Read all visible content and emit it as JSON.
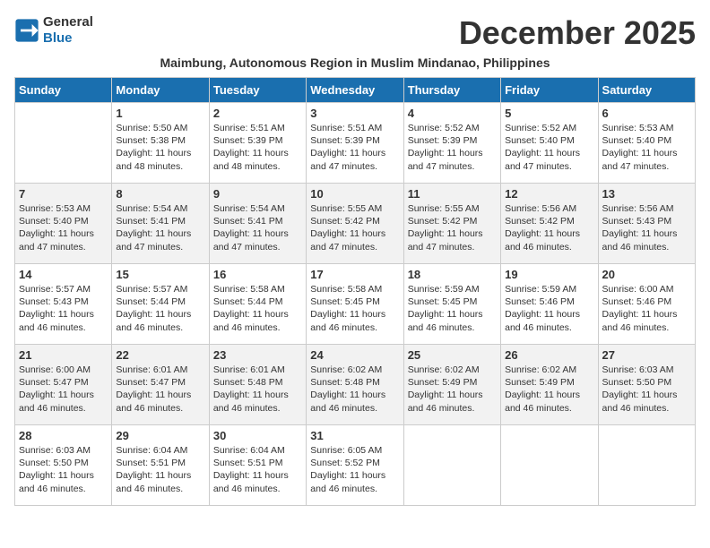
{
  "logo": {
    "text_general": "General",
    "text_blue": "Blue"
  },
  "title": "December 2025",
  "subtitle": "Maimbung, Autonomous Region in Muslim Mindanao, Philippines",
  "headers": [
    "Sunday",
    "Monday",
    "Tuesday",
    "Wednesday",
    "Thursday",
    "Friday",
    "Saturday"
  ],
  "weeks": [
    [
      {
        "day": "",
        "info": ""
      },
      {
        "day": "1",
        "info": "Sunrise: 5:50 AM\nSunset: 5:38 PM\nDaylight: 11 hours\nand 48 minutes."
      },
      {
        "day": "2",
        "info": "Sunrise: 5:51 AM\nSunset: 5:39 PM\nDaylight: 11 hours\nand 48 minutes."
      },
      {
        "day": "3",
        "info": "Sunrise: 5:51 AM\nSunset: 5:39 PM\nDaylight: 11 hours\nand 47 minutes."
      },
      {
        "day": "4",
        "info": "Sunrise: 5:52 AM\nSunset: 5:39 PM\nDaylight: 11 hours\nand 47 minutes."
      },
      {
        "day": "5",
        "info": "Sunrise: 5:52 AM\nSunset: 5:40 PM\nDaylight: 11 hours\nand 47 minutes."
      },
      {
        "day": "6",
        "info": "Sunrise: 5:53 AM\nSunset: 5:40 PM\nDaylight: 11 hours\nand 47 minutes."
      }
    ],
    [
      {
        "day": "7",
        "info": "Sunrise: 5:53 AM\nSunset: 5:40 PM\nDaylight: 11 hours\nand 47 minutes."
      },
      {
        "day": "8",
        "info": "Sunrise: 5:54 AM\nSunset: 5:41 PM\nDaylight: 11 hours\nand 47 minutes."
      },
      {
        "day": "9",
        "info": "Sunrise: 5:54 AM\nSunset: 5:41 PM\nDaylight: 11 hours\nand 47 minutes."
      },
      {
        "day": "10",
        "info": "Sunrise: 5:55 AM\nSunset: 5:42 PM\nDaylight: 11 hours\nand 47 minutes."
      },
      {
        "day": "11",
        "info": "Sunrise: 5:55 AM\nSunset: 5:42 PM\nDaylight: 11 hours\nand 47 minutes."
      },
      {
        "day": "12",
        "info": "Sunrise: 5:56 AM\nSunset: 5:42 PM\nDaylight: 11 hours\nand 46 minutes."
      },
      {
        "day": "13",
        "info": "Sunrise: 5:56 AM\nSunset: 5:43 PM\nDaylight: 11 hours\nand 46 minutes."
      }
    ],
    [
      {
        "day": "14",
        "info": "Sunrise: 5:57 AM\nSunset: 5:43 PM\nDaylight: 11 hours\nand 46 minutes."
      },
      {
        "day": "15",
        "info": "Sunrise: 5:57 AM\nSunset: 5:44 PM\nDaylight: 11 hours\nand 46 minutes."
      },
      {
        "day": "16",
        "info": "Sunrise: 5:58 AM\nSunset: 5:44 PM\nDaylight: 11 hours\nand 46 minutes."
      },
      {
        "day": "17",
        "info": "Sunrise: 5:58 AM\nSunset: 5:45 PM\nDaylight: 11 hours\nand 46 minutes."
      },
      {
        "day": "18",
        "info": "Sunrise: 5:59 AM\nSunset: 5:45 PM\nDaylight: 11 hours\nand 46 minutes."
      },
      {
        "day": "19",
        "info": "Sunrise: 5:59 AM\nSunset: 5:46 PM\nDaylight: 11 hours\nand 46 minutes."
      },
      {
        "day": "20",
        "info": "Sunrise: 6:00 AM\nSunset: 5:46 PM\nDaylight: 11 hours\nand 46 minutes."
      }
    ],
    [
      {
        "day": "21",
        "info": "Sunrise: 6:00 AM\nSunset: 5:47 PM\nDaylight: 11 hours\nand 46 minutes."
      },
      {
        "day": "22",
        "info": "Sunrise: 6:01 AM\nSunset: 5:47 PM\nDaylight: 11 hours\nand 46 minutes."
      },
      {
        "day": "23",
        "info": "Sunrise: 6:01 AM\nSunset: 5:48 PM\nDaylight: 11 hours\nand 46 minutes."
      },
      {
        "day": "24",
        "info": "Sunrise: 6:02 AM\nSunset: 5:48 PM\nDaylight: 11 hours\nand 46 minutes."
      },
      {
        "day": "25",
        "info": "Sunrise: 6:02 AM\nSunset: 5:49 PM\nDaylight: 11 hours\nand 46 minutes."
      },
      {
        "day": "26",
        "info": "Sunrise: 6:02 AM\nSunset: 5:49 PM\nDaylight: 11 hours\nand 46 minutes."
      },
      {
        "day": "27",
        "info": "Sunrise: 6:03 AM\nSunset: 5:50 PM\nDaylight: 11 hours\nand 46 minutes."
      }
    ],
    [
      {
        "day": "28",
        "info": "Sunrise: 6:03 AM\nSunset: 5:50 PM\nDaylight: 11 hours\nand 46 minutes."
      },
      {
        "day": "29",
        "info": "Sunrise: 6:04 AM\nSunset: 5:51 PM\nDaylight: 11 hours\nand 46 minutes."
      },
      {
        "day": "30",
        "info": "Sunrise: 6:04 AM\nSunset: 5:51 PM\nDaylight: 11 hours\nand 46 minutes."
      },
      {
        "day": "31",
        "info": "Sunrise: 6:05 AM\nSunset: 5:52 PM\nDaylight: 11 hours\nand 46 minutes."
      },
      {
        "day": "",
        "info": ""
      },
      {
        "day": "",
        "info": ""
      },
      {
        "day": "",
        "info": ""
      }
    ]
  ]
}
